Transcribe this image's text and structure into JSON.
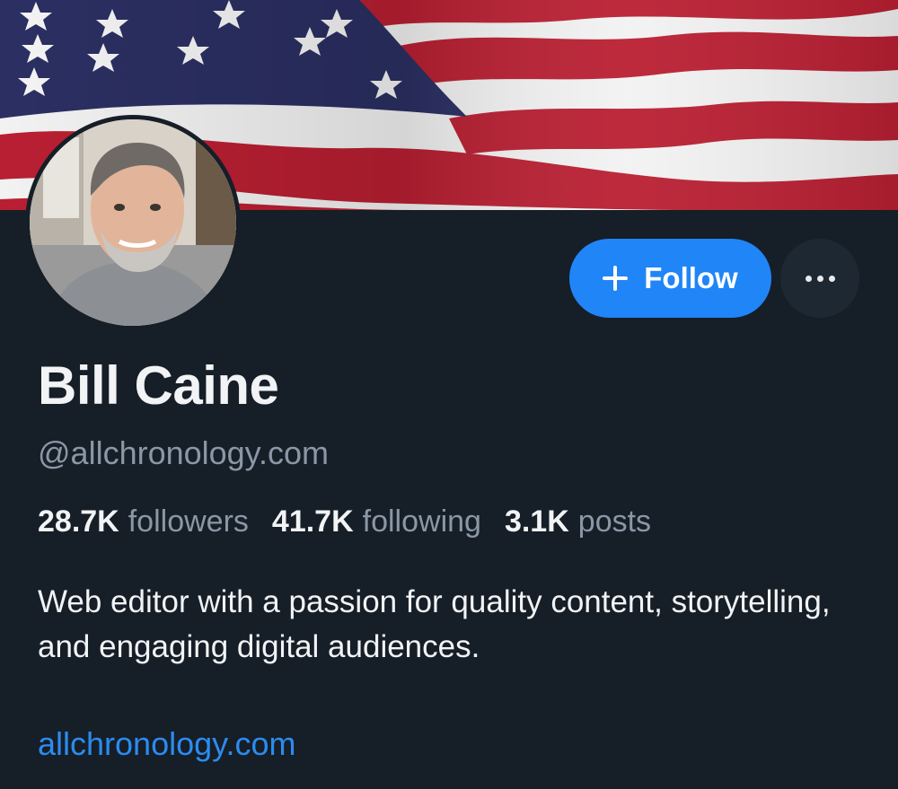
{
  "profile": {
    "display_name": "Bill Caine",
    "handle": "@allchronology.com",
    "bio": "Web editor with a passion for quality content, storytelling, and engaging digital audiences.",
    "website": "allchronology.com"
  },
  "stats": {
    "followers_count": "28.7K",
    "followers_label": "followers",
    "following_count": "41.7K",
    "following_label": "following",
    "posts_count": "3.1K",
    "posts_label": "posts"
  },
  "actions": {
    "follow_label": "Follow",
    "follow_icon": "plus-icon",
    "more_icon": "ellipsis-icon"
  },
  "banner": {
    "description_icon": "american-flag",
    "colors": {
      "red": "#b91f32",
      "white": "#f2f2f2",
      "blue": "#2b2f62"
    }
  },
  "theme": {
    "background": "#161e27",
    "accent": "#2085f7",
    "link": "#2b8cf0",
    "muted_text": "#8a97a6",
    "text": "#f1f3f5"
  }
}
